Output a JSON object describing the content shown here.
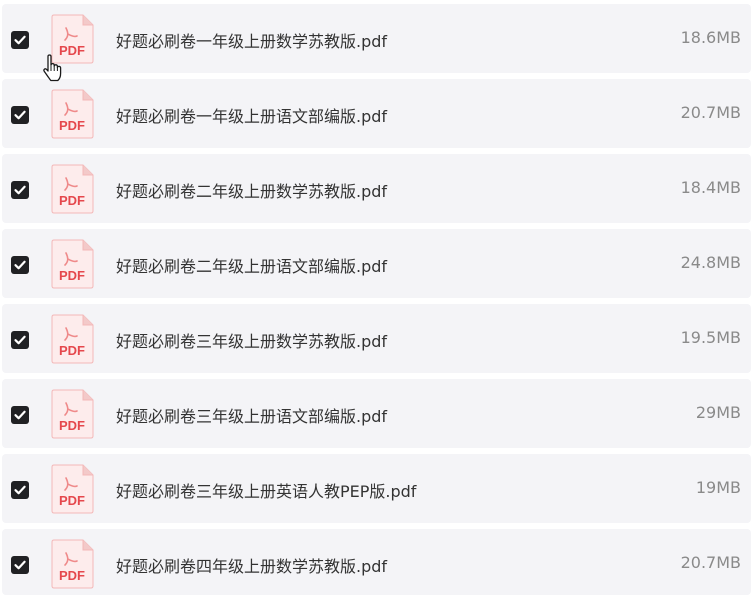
{
  "files": [
    {
      "name": "好题必刷卷一年级上册数学苏教版.pdf",
      "size": "18.6MB",
      "checked": true
    },
    {
      "name": "好题必刷卷一年级上册语文部编版.pdf",
      "size": "20.7MB",
      "checked": true
    },
    {
      "name": "好题必刷卷二年级上册数学苏教版.pdf",
      "size": "18.4MB",
      "checked": true
    },
    {
      "name": "好题必刷卷二年级上册语文部编版.pdf",
      "size": "24.8MB",
      "checked": true
    },
    {
      "name": "好题必刷卷三年级上册数学苏教版.pdf",
      "size": "19.5MB",
      "checked": true
    },
    {
      "name": "好题必刷卷三年级上册语文部编版.pdf",
      "size": "29MB",
      "checked": true
    },
    {
      "name": "好题必刷卷三年级上册英语人教PEP版.pdf",
      "size": "19MB",
      "checked": true
    },
    {
      "name": "好题必刷卷四年级上册数学苏教版.pdf",
      "size": "20.7MB",
      "checked": true
    }
  ],
  "icons": {
    "checkbox": "checkbox-checked-icon",
    "file": "pdf-file-icon",
    "file_label": "PDF",
    "cursor": "hand-pointer-cursor-icon"
  },
  "colors": {
    "row_bg": "#f4f4f7",
    "checkbox": "#202124",
    "pdf_red": "#e5484d",
    "pdf_bg": "#fdecec",
    "name_text": "#333333",
    "size_text": "#8a8a8a"
  }
}
